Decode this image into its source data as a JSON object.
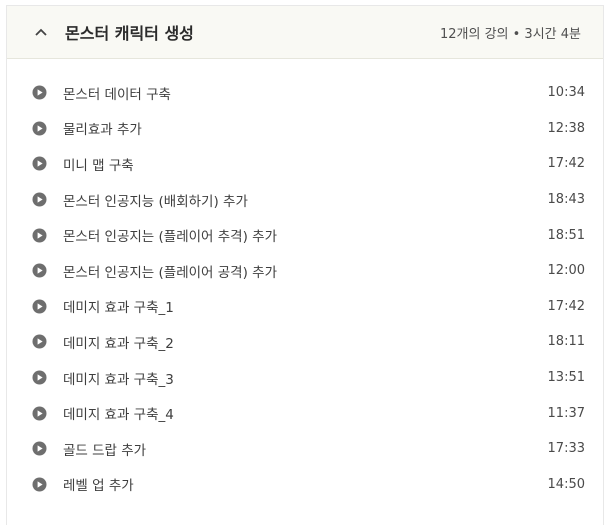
{
  "section": {
    "title": "몬스터 캐릭터 생성",
    "meta": "12개의 강의 • 3시간 4분",
    "expanded": true,
    "toggle_icon": "chevron-up-icon"
  },
  "colors": {
    "header_bg": "#f9f9f4",
    "play_icon": "#6e6e6e",
    "text": "#3e3e3e"
  },
  "lectures": [
    {
      "title": "몬스터 데이터 구축",
      "duration": "10:34",
      "icon": "play-circle-icon"
    },
    {
      "title": "물리효과 추가",
      "duration": "12:38",
      "icon": "play-circle-icon"
    },
    {
      "title": "미니 맵 구축",
      "duration": "17:42",
      "icon": "play-circle-icon"
    },
    {
      "title": "몬스터 인공지능 (배회하기) 추가",
      "duration": "18:43",
      "icon": "play-circle-icon"
    },
    {
      "title": "몬스터 인공지는 (플레이어 추격) 추가",
      "duration": "18:51",
      "icon": "play-circle-icon"
    },
    {
      "title": "몬스터 인공지는 (플레이어 공격) 추가",
      "duration": "12:00",
      "icon": "play-circle-icon"
    },
    {
      "title": "데미지 효과 구축_1",
      "duration": "17:42",
      "icon": "play-circle-icon"
    },
    {
      "title": "데미지 효과 구축_2",
      "duration": "18:11",
      "icon": "play-circle-icon"
    },
    {
      "title": "데미지 효과 구축_3",
      "duration": "13:51",
      "icon": "play-circle-icon"
    },
    {
      "title": "데미지 효과 구축_4",
      "duration": "11:37",
      "icon": "play-circle-icon"
    },
    {
      "title": "골드 드랍 추가",
      "duration": "17:33",
      "icon": "play-circle-icon"
    },
    {
      "title": "레벨 업 추가",
      "duration": "14:50",
      "icon": "play-circle-icon"
    }
  ]
}
